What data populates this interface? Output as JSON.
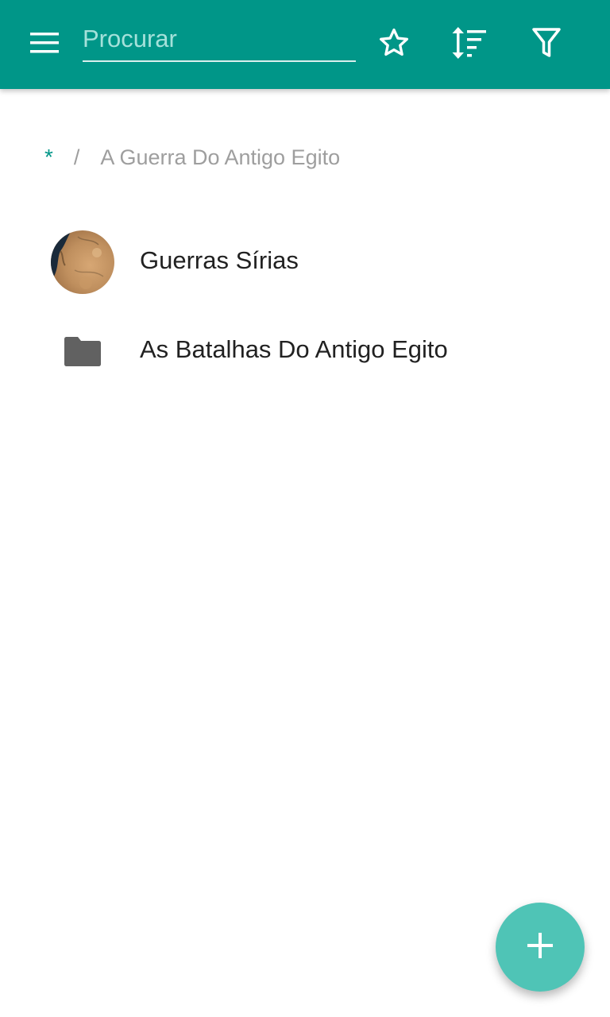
{
  "toolbar": {
    "background_color": "#009688",
    "menu_icon": "hamburger-menu-icon",
    "search": {
      "value": "",
      "placeholder": "Procurar"
    },
    "actions": [
      {
        "icon": "star-outline-icon"
      },
      {
        "icon": "sort-icon"
      },
      {
        "icon": "filter-icon"
      }
    ]
  },
  "breadcrumb": {
    "root": "*",
    "separator": "/",
    "current": "A Guerra Do Antigo Egito"
  },
  "items": [
    {
      "label": "Guerras Sírias",
      "icon": "desert-map-avatar"
    },
    {
      "label": "As Batalhas Do Antigo Egito",
      "icon": "folder-icon"
    }
  ],
  "fab": {
    "icon": "add-icon",
    "color": "#4fc4b6"
  }
}
